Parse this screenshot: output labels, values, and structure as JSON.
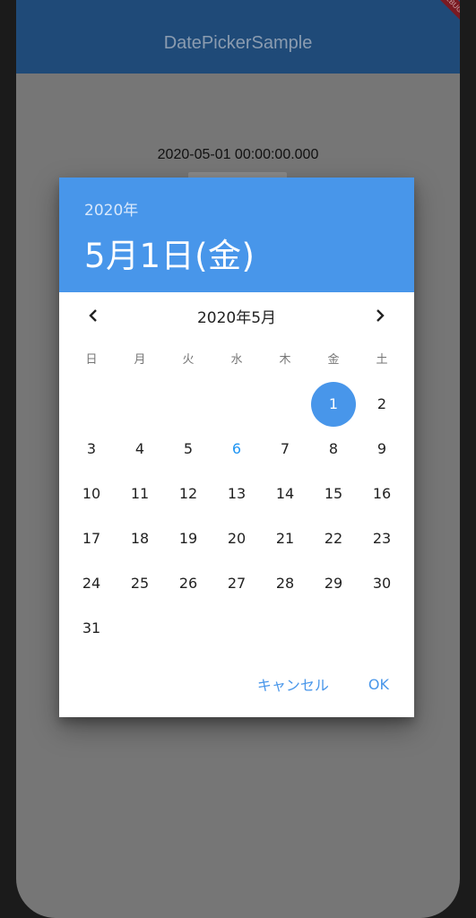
{
  "app": {
    "title": "DatePickerSample",
    "debug_banner": "DEBUG"
  },
  "body": {
    "selected_datetime": "2020-05-01 00:00:00.000"
  },
  "dialog": {
    "header_year": "2020年",
    "header_date": "5月1日(金)",
    "month_label": "2020年5月",
    "weekdays": [
      "日",
      "月",
      "火",
      "水",
      "木",
      "金",
      "土"
    ],
    "leading_blanks": 5,
    "days": [
      "1",
      "2",
      "3",
      "4",
      "5",
      "6",
      "7",
      "8",
      "9",
      "10",
      "11",
      "12",
      "13",
      "14",
      "15",
      "16",
      "17",
      "18",
      "19",
      "20",
      "21",
      "22",
      "23",
      "24",
      "25",
      "26",
      "27",
      "28",
      "29",
      "30",
      "31"
    ],
    "selected_day": "1",
    "today_day": "6",
    "cancel_label": "キャンセル",
    "ok_label": "OK"
  },
  "colors": {
    "appbar": "#1f4a78",
    "header": "#4896ea",
    "accent": "#4896ea",
    "today": "#2196f3",
    "scrim": "#767676"
  },
  "icons": {
    "prev": "chevron-left-icon",
    "next": "chevron-right-icon"
  }
}
